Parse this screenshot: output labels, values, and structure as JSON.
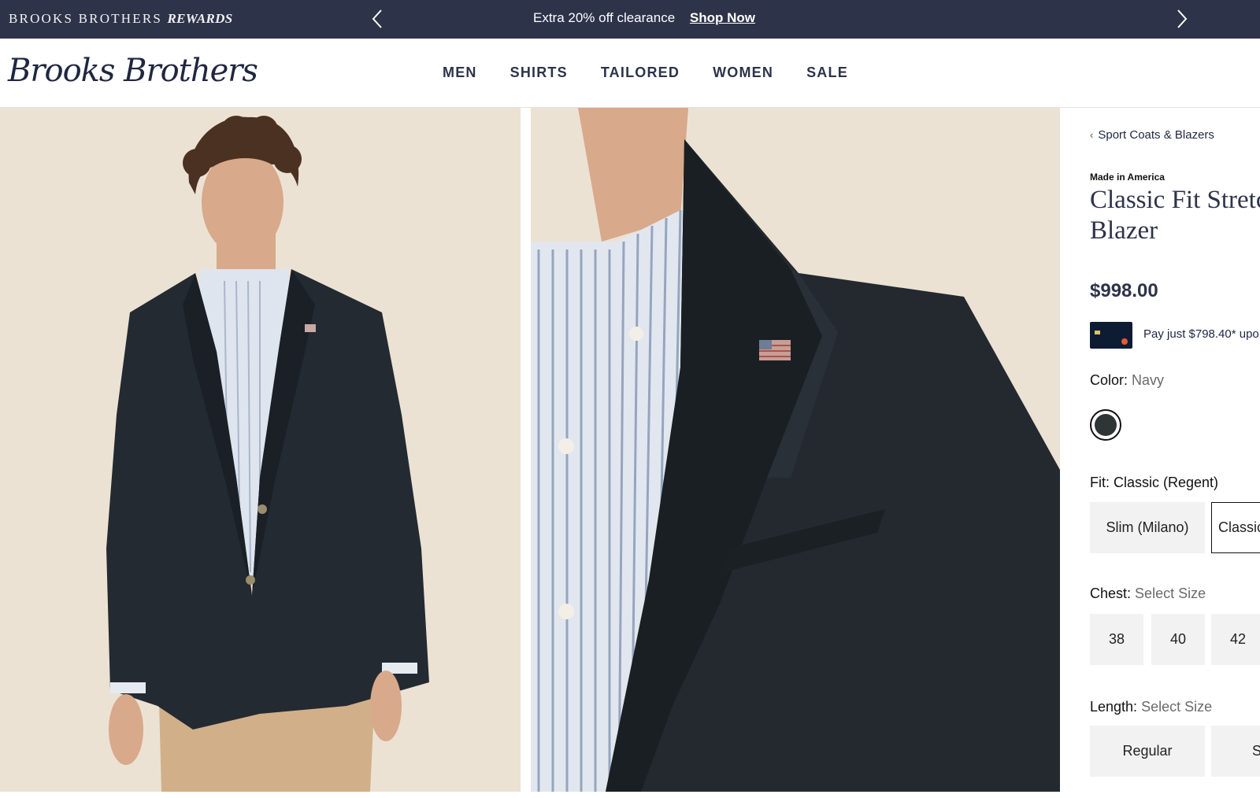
{
  "promo": {
    "rewards_brand": "BROOKS BROTHERS",
    "rewards_word": "REWARDS",
    "message": "Extra 20% off clearance",
    "cta": "Shop Now"
  },
  "header": {
    "logo": "Brooks Brothers",
    "nav": [
      "MEN",
      "SHIRTS",
      "TAILORED",
      "WOMEN",
      "SALE"
    ]
  },
  "product": {
    "breadcrumb": "Sport Coats & Blazers",
    "made_in": "Made in America",
    "title_line1": "Classic Fit Stretch",
    "title_line2": "Blazer",
    "price": "$998.00",
    "pay_text": "Pay just $798.40* upo",
    "color_label": "Color:",
    "color_value": "Navy",
    "fit_label": "Fit: Classic (Regent)",
    "fit_options": [
      "Slim (Milano)",
      "Classic"
    ],
    "chest_label": "Chest:",
    "chest_value": "Select Size",
    "chest_options": [
      "38",
      "40",
      "42"
    ],
    "length_label": "Length:",
    "length_value": "Select Size",
    "length_options": [
      "Regular",
      "S"
    ]
  },
  "icons": {
    "promo_prev": "chevron-left-icon",
    "promo_next": "chevron-right-icon",
    "breadcrumb_back": "chevron-left-icon",
    "breadcrumb_menu": "chevron-down-icon"
  },
  "colors": {
    "promo_bg": "#2d3349",
    "brand_navy": "#1f2740",
    "photo_bg": "#ebe2d4",
    "option_bg": "#f2f2f2"
  }
}
